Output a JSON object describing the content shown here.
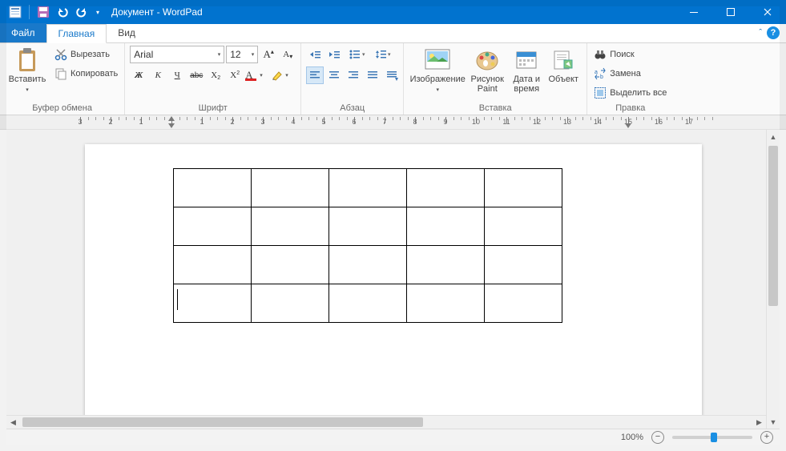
{
  "title": "Документ - WordPad",
  "tabs": {
    "file": "Файл",
    "home": "Главная",
    "view": "Вид"
  },
  "groups": {
    "clipboard": {
      "label": "Буфер обмена",
      "paste": "Вставить",
      "cut": "Вырезать",
      "copy": "Копировать"
    },
    "font": {
      "label": "Шрифт",
      "name": "Arial",
      "size": "12"
    },
    "paragraph": {
      "label": "Абзац"
    },
    "insert": {
      "label": "Вставка",
      "image": "Изображение",
      "paint": "Рисунок\nPaint",
      "datetime": "Дата и\nвремя",
      "object": "Объект"
    },
    "editing": {
      "label": "Правка",
      "find": "Поиск",
      "replace": "Замена",
      "selectall": "Выделить все"
    }
  },
  "status": {
    "zoom": "100%"
  },
  "ruler": {
    "labels": [
      "3",
      "2",
      "1",
      "1",
      "2",
      "3",
      "4",
      "5",
      "6",
      "7",
      "8",
      "9",
      "10",
      "11",
      "12",
      "13",
      "14",
      "15",
      "16",
      "17"
    ]
  },
  "doc": {
    "rows": 4,
    "cols": 5
  }
}
